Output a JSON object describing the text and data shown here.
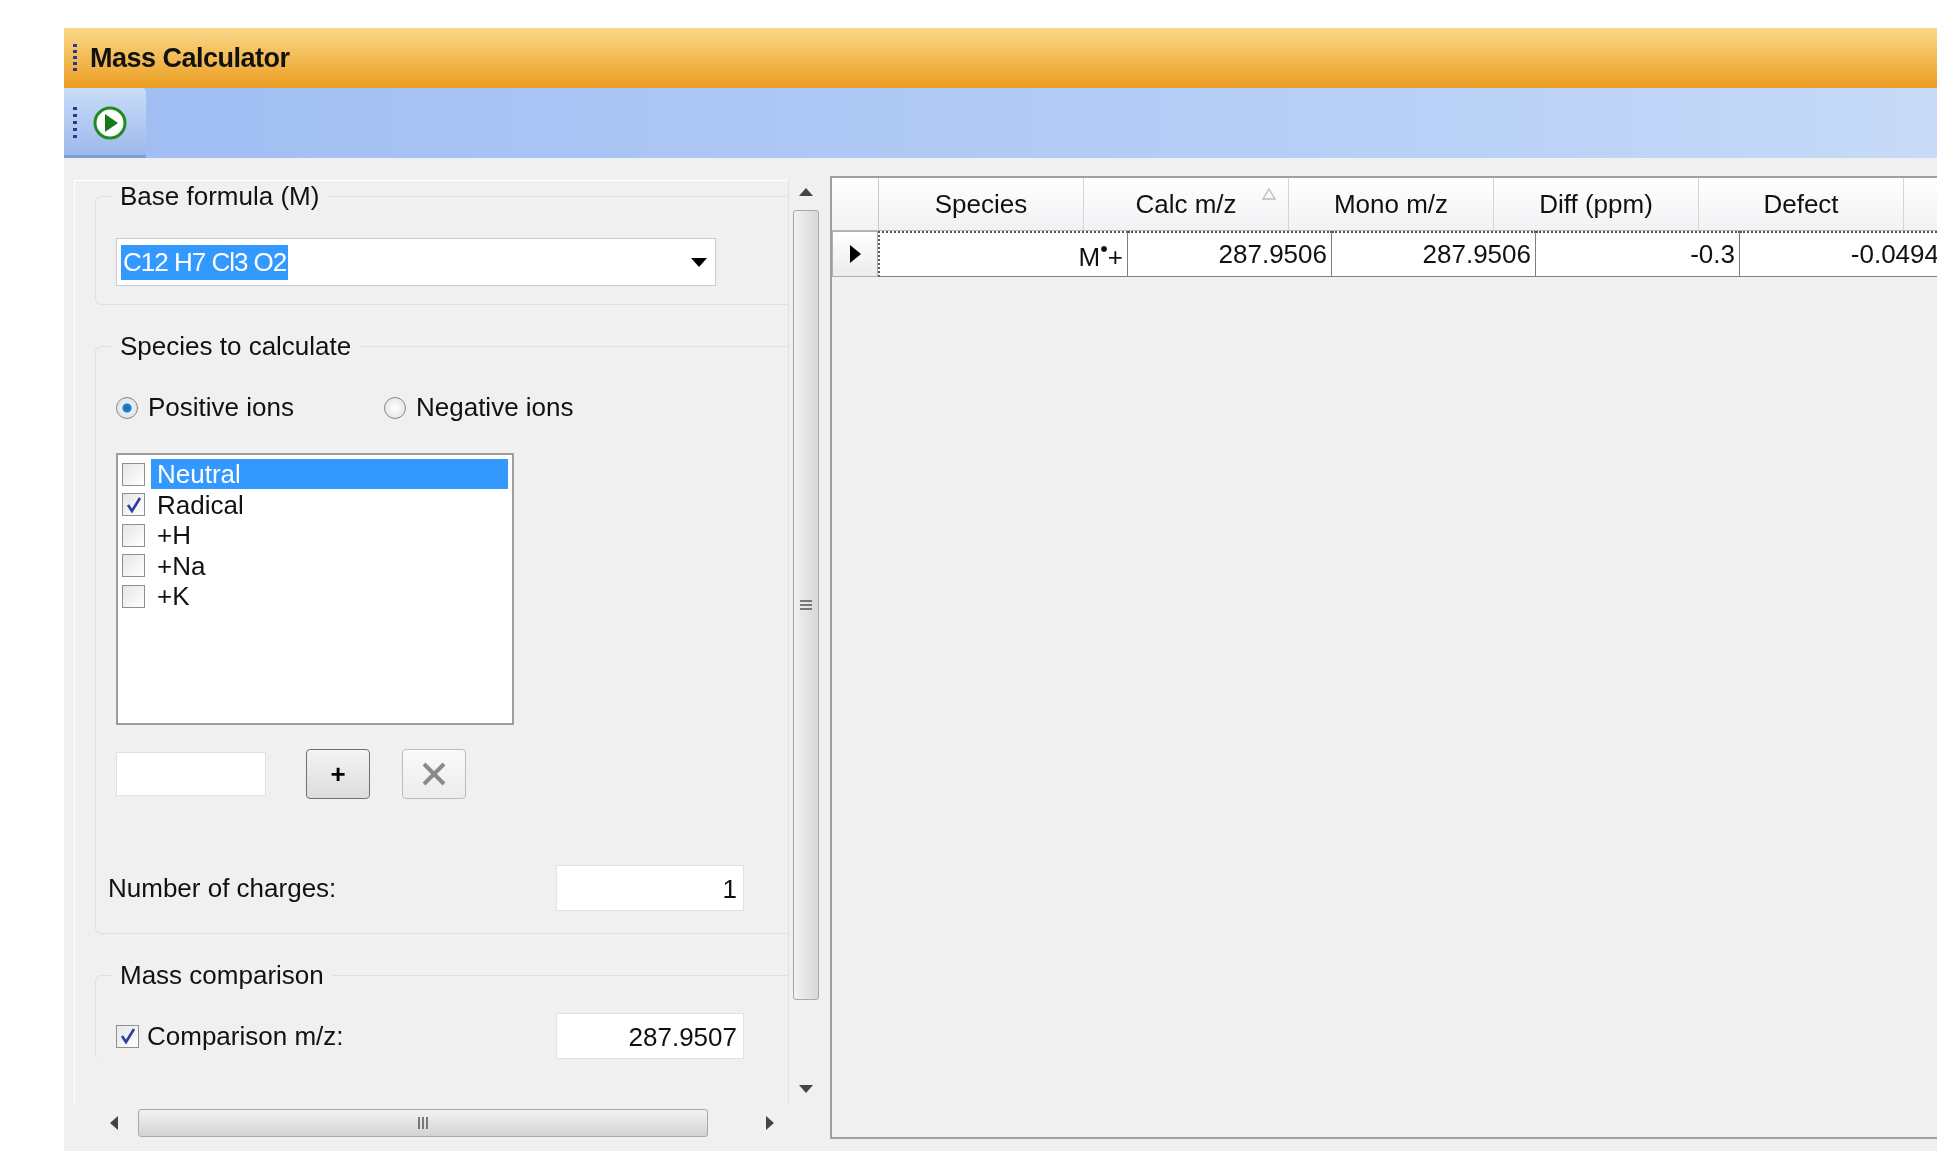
{
  "window": {
    "title": "Mass Calculator"
  },
  "base_formula": {
    "label": "Base formula (M)",
    "value": "C12 H7 Cl3 O2",
    "text_selected": true
  },
  "species": {
    "label": "Species to calculate",
    "ion_modes": [
      {
        "label": "Positive ions",
        "selected": true
      },
      {
        "label": "Negative ions",
        "selected": false
      }
    ],
    "items": [
      {
        "label": "Neutral",
        "checked": false,
        "selected": true
      },
      {
        "label": "Radical",
        "checked": true,
        "selected": false
      },
      {
        "label": "+H",
        "checked": false,
        "selected": false
      },
      {
        "label": "+Na",
        "checked": false,
        "selected": false
      },
      {
        "label": "+K",
        "checked": false,
        "selected": false
      }
    ],
    "add_button": "+",
    "charges_label": "Number of charges:",
    "charges_value": "1"
  },
  "mass_comparison": {
    "label": "Mass comparison",
    "checkbox_label": "Comparison m/z:",
    "checked": true,
    "value": "287.9507"
  },
  "grid": {
    "columns": [
      {
        "label": "Species",
        "sorted": false
      },
      {
        "label": "Calc m/z",
        "sorted": true
      },
      {
        "label": "Mono m/z",
        "sorted": false
      },
      {
        "label": "Diff (ppm)",
        "sorted": false
      },
      {
        "label": "Defect",
        "sorted": false
      }
    ],
    "rows": [
      {
        "current": true,
        "cells": [
          "M$^{•}$+",
          "287.9506",
          "287.9506",
          "-0.3",
          "-0.0494"
        ]
      }
    ]
  }
}
